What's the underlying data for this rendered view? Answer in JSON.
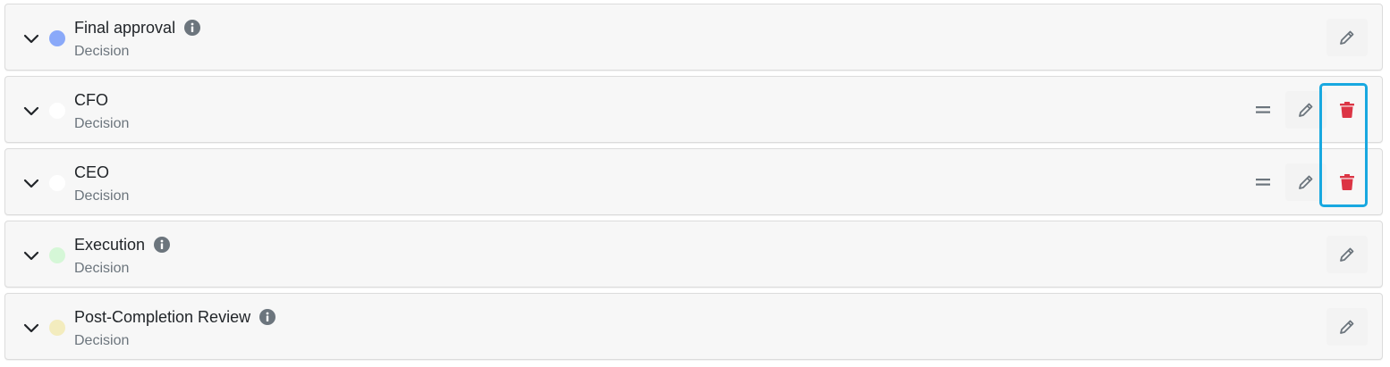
{
  "stages": [
    {
      "title": "Final approval",
      "subtitle": "Decision",
      "dot_color": "#8aa9f9",
      "has_info": true,
      "draggable": false,
      "deletable": false
    },
    {
      "title": "CFO",
      "subtitle": "Decision",
      "dot_color": "#ffffff",
      "has_info": false,
      "draggable": true,
      "deletable": true
    },
    {
      "title": "CEO",
      "subtitle": "Decision",
      "dot_color": "#ffffff",
      "has_info": false,
      "draggable": true,
      "deletable": true
    },
    {
      "title": "Execution",
      "subtitle": "Decision",
      "dot_color": "#d5f7d7",
      "has_info": true,
      "draggable": false,
      "deletable": false
    },
    {
      "title": "Post-Completion Review",
      "subtitle": "Decision",
      "dot_color": "#f3ecbe",
      "has_info": true,
      "draggable": false,
      "deletable": false
    }
  ],
  "icons": {
    "chevron": "chevron-down-icon",
    "info": "info-circle-icon",
    "drag": "drag-handle-icon",
    "edit": "pencil-icon",
    "delete": "trash-icon"
  },
  "colors": {
    "delete": "#dc3545",
    "edit": "#6c757d",
    "highlight": "#18a8e0"
  }
}
